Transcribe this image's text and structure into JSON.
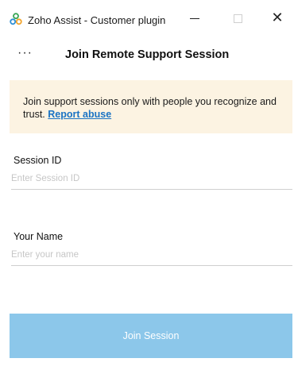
{
  "window": {
    "title": "Zoho Assist - Customer plugin",
    "logo_icon": "zoho-assist-logo-icon",
    "minimize_icon": "minimize-icon",
    "maximize_icon": "maximize-icon",
    "close_icon": "close-icon",
    "close_glyph": "✕"
  },
  "header": {
    "more_label": "···",
    "title": "Join Remote Support Session"
  },
  "notice": {
    "text": "Join support sessions only with people you recognize and trust.",
    "link_label": "Report abuse",
    "background": "#fcf3e2",
    "link_color": "#1a73c4"
  },
  "form": {
    "session_id": {
      "label": "Session ID",
      "placeholder": "Enter Session ID",
      "value": ""
    },
    "your_name": {
      "label": "Your Name",
      "placeholder": "Enter your name",
      "value": ""
    }
  },
  "actions": {
    "join_label": "Join Session",
    "join_color": "#8cc7ea"
  }
}
